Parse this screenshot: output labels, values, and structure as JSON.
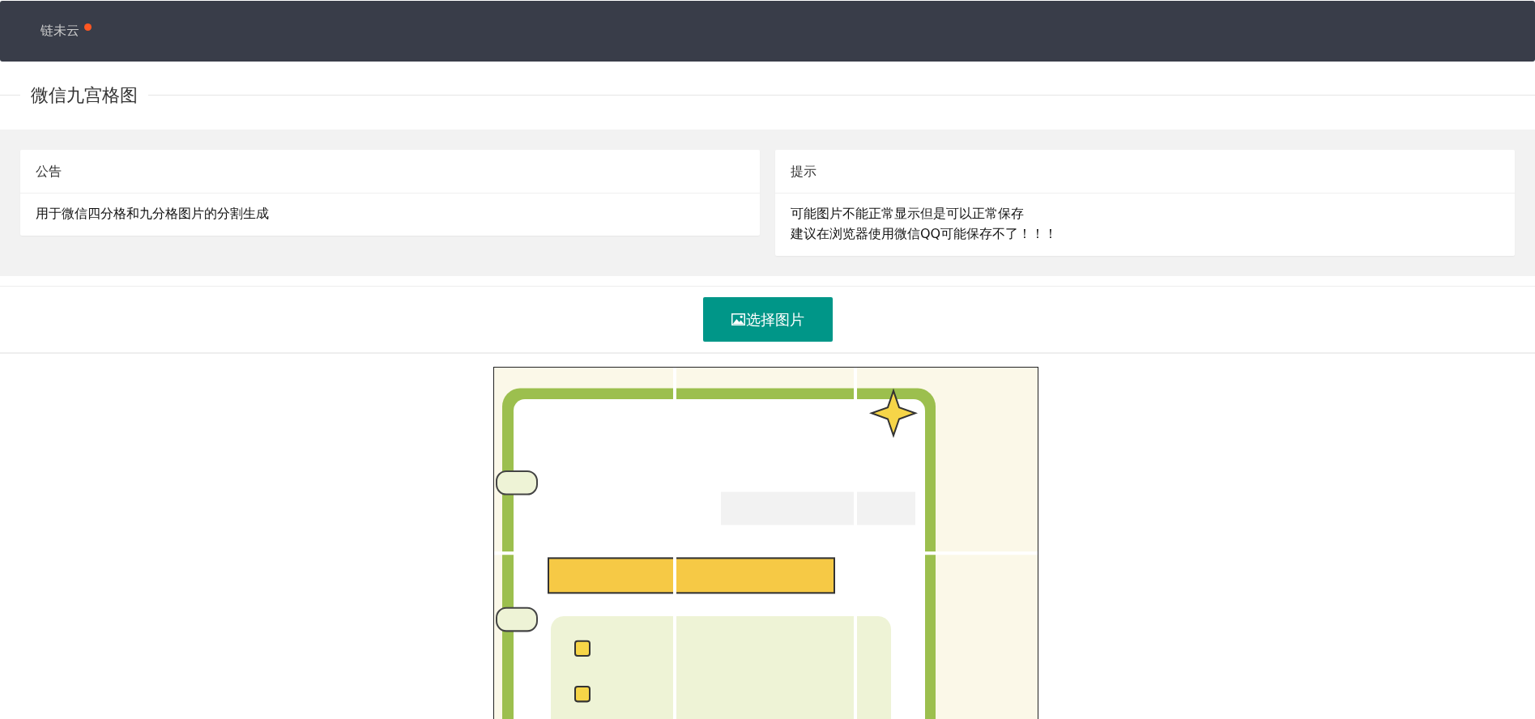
{
  "header": {
    "title": "链未云",
    "badge_dot": true
  },
  "page_title": "微信九宫格图",
  "cards": [
    {
      "title": "公告",
      "lines": [
        "用于微信四分格和九分格图片的分割生成"
      ]
    },
    {
      "title": "提示",
      "lines": [
        "可能图片不能正常显示但是可以正常保存",
        "建议在浏览器使用微信QQ可能保存不了！！！"
      ]
    }
  ],
  "select_button": {
    "label": "选择图片"
  }
}
